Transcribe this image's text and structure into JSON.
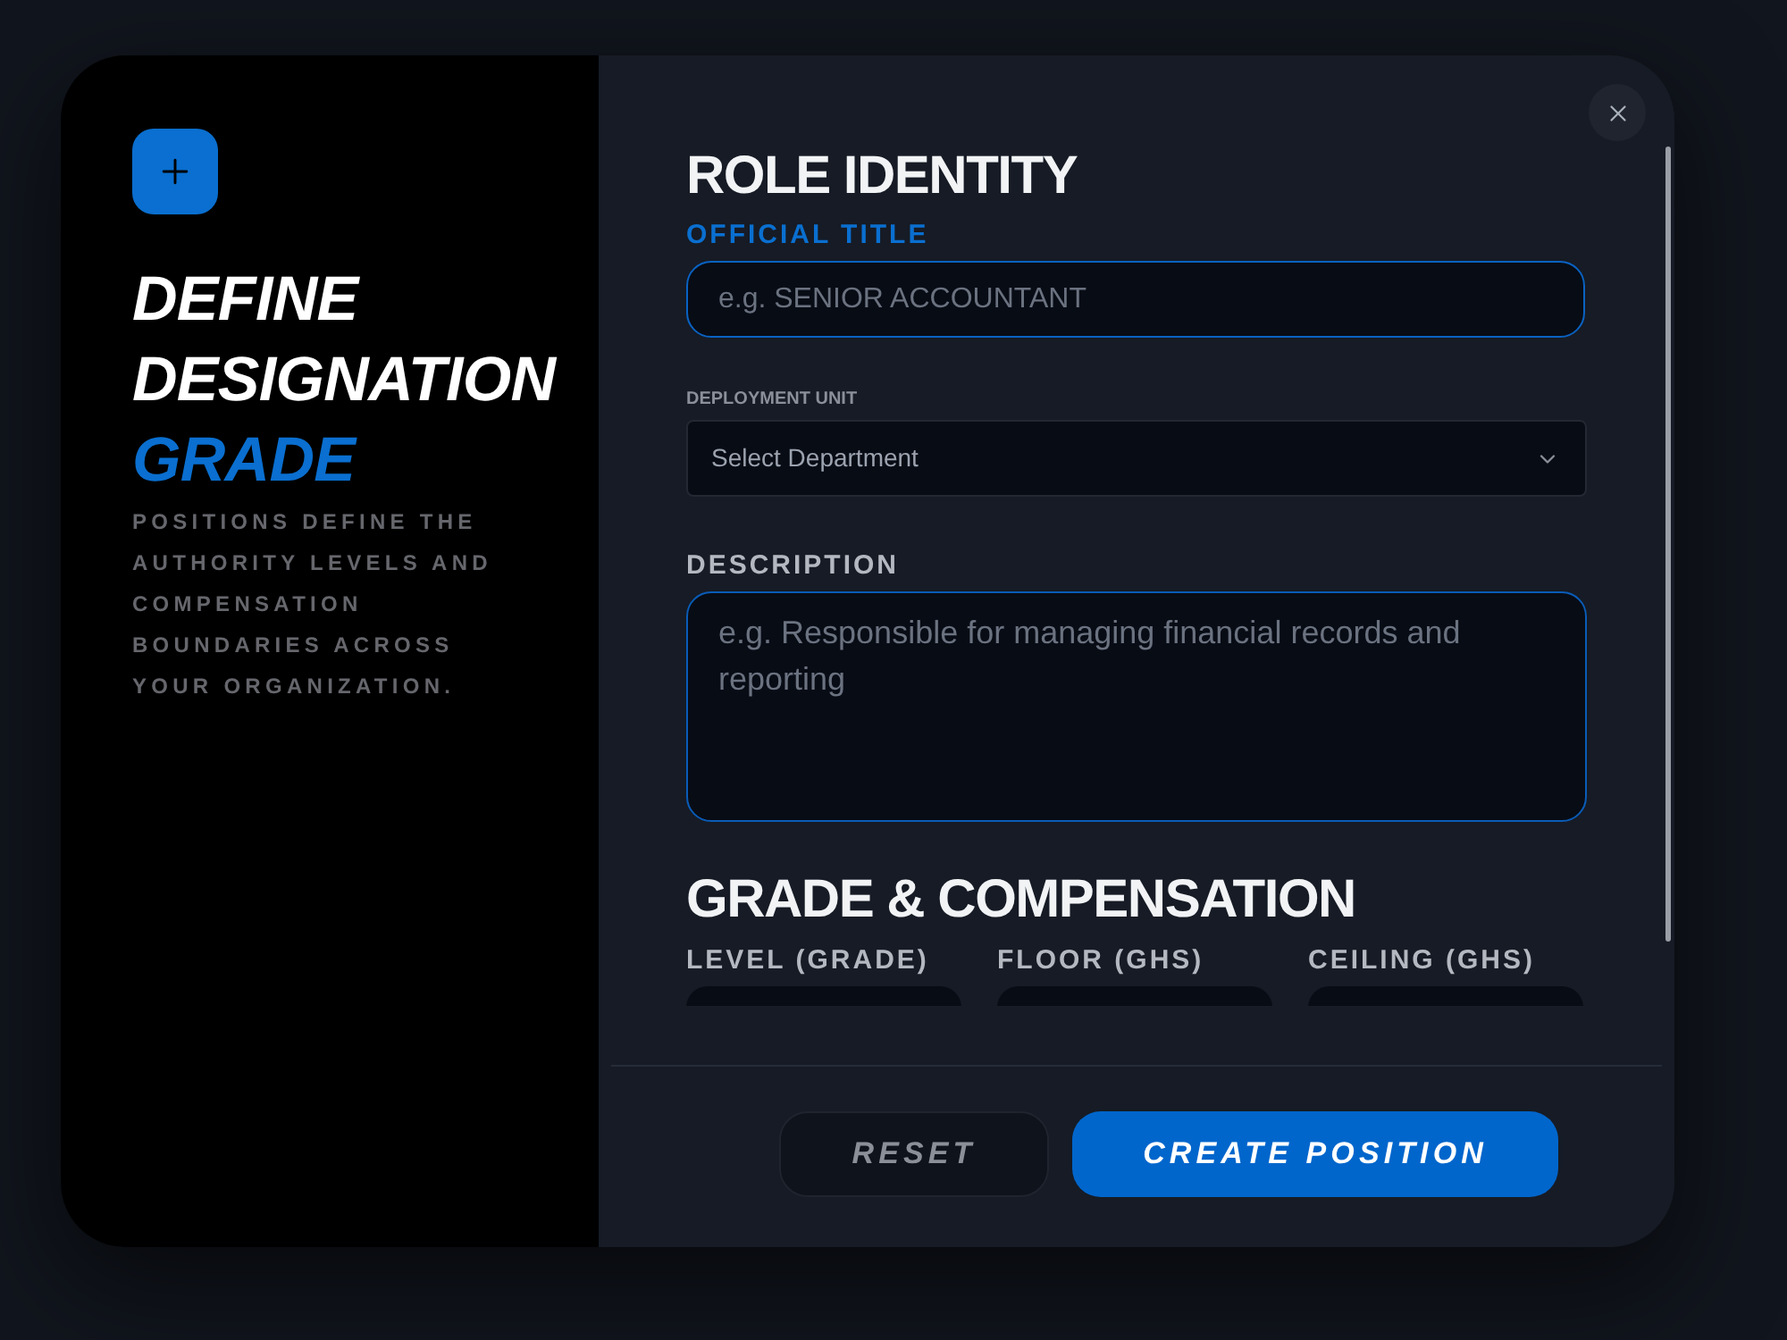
{
  "sidebar": {
    "title": "DEFINE DESIGNATION",
    "title_accent": "GRADE",
    "description": "POSITIONS DEFINE THE AUTHORITY LEVELS AND COMPENSATION BOUNDARIES ACROSS YOUR ORGANIZATION."
  },
  "role_identity": {
    "heading": "ROLE IDENTITY",
    "official_title": {
      "label": "OFFICIAL TITLE",
      "placeholder": "e.g. SENIOR ACCOUNTANT",
      "focused": true
    },
    "deployment_unit": {
      "label": "DEPLOYMENT UNIT",
      "value": "Select Department"
    },
    "description": {
      "label": "DESCRIPTION",
      "placeholder": "e.g. Responsible for managing financial records and reporting"
    }
  },
  "grade_compensation": {
    "heading": "GRADE & COMPENSATION",
    "fields": [
      {
        "label": "LEVEL (GRADE)"
      },
      {
        "label": "FLOOR (GHS)"
      },
      {
        "label": "CEILING (GHS)"
      }
    ]
  },
  "buttons": [
    {
      "label": "RESET",
      "kind": "secondary"
    },
    {
      "label": "CREATE POSITION",
      "kind": "primary"
    }
  ]
}
